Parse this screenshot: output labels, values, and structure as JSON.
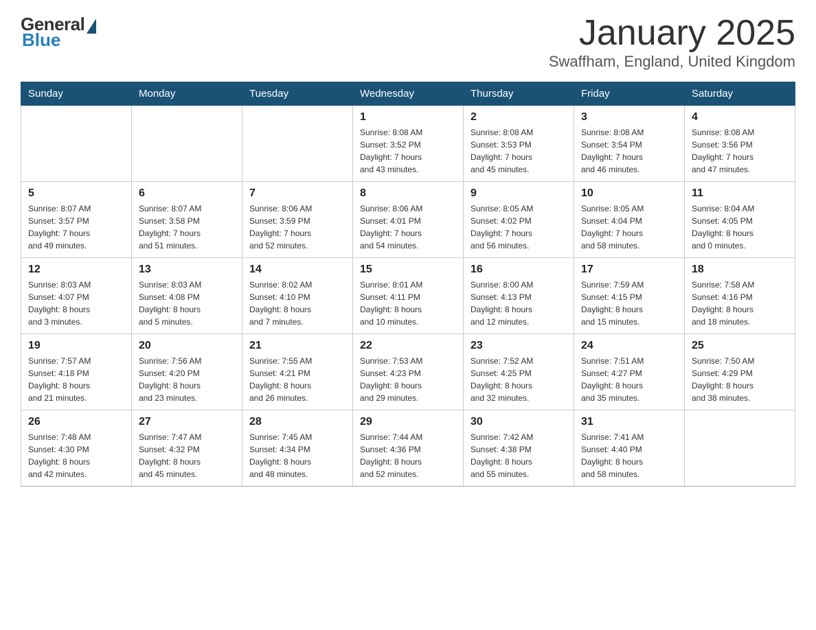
{
  "header": {
    "logo": {
      "general": "General",
      "blue": "Blue"
    },
    "title": "January 2025",
    "location": "Swaffham, England, United Kingdom"
  },
  "calendar": {
    "weekdays": [
      "Sunday",
      "Monday",
      "Tuesday",
      "Wednesday",
      "Thursday",
      "Friday",
      "Saturday"
    ],
    "weeks": [
      [
        {
          "day": "",
          "info": ""
        },
        {
          "day": "",
          "info": ""
        },
        {
          "day": "",
          "info": ""
        },
        {
          "day": "1",
          "info": "Sunrise: 8:08 AM\nSunset: 3:52 PM\nDaylight: 7 hours\nand 43 minutes."
        },
        {
          "day": "2",
          "info": "Sunrise: 8:08 AM\nSunset: 3:53 PM\nDaylight: 7 hours\nand 45 minutes."
        },
        {
          "day": "3",
          "info": "Sunrise: 8:08 AM\nSunset: 3:54 PM\nDaylight: 7 hours\nand 46 minutes."
        },
        {
          "day": "4",
          "info": "Sunrise: 8:08 AM\nSunset: 3:56 PM\nDaylight: 7 hours\nand 47 minutes."
        }
      ],
      [
        {
          "day": "5",
          "info": "Sunrise: 8:07 AM\nSunset: 3:57 PM\nDaylight: 7 hours\nand 49 minutes."
        },
        {
          "day": "6",
          "info": "Sunrise: 8:07 AM\nSunset: 3:58 PM\nDaylight: 7 hours\nand 51 minutes."
        },
        {
          "day": "7",
          "info": "Sunrise: 8:06 AM\nSunset: 3:59 PM\nDaylight: 7 hours\nand 52 minutes."
        },
        {
          "day": "8",
          "info": "Sunrise: 8:06 AM\nSunset: 4:01 PM\nDaylight: 7 hours\nand 54 minutes."
        },
        {
          "day": "9",
          "info": "Sunrise: 8:05 AM\nSunset: 4:02 PM\nDaylight: 7 hours\nand 56 minutes."
        },
        {
          "day": "10",
          "info": "Sunrise: 8:05 AM\nSunset: 4:04 PM\nDaylight: 7 hours\nand 58 minutes."
        },
        {
          "day": "11",
          "info": "Sunrise: 8:04 AM\nSunset: 4:05 PM\nDaylight: 8 hours\nand 0 minutes."
        }
      ],
      [
        {
          "day": "12",
          "info": "Sunrise: 8:03 AM\nSunset: 4:07 PM\nDaylight: 8 hours\nand 3 minutes."
        },
        {
          "day": "13",
          "info": "Sunrise: 8:03 AM\nSunset: 4:08 PM\nDaylight: 8 hours\nand 5 minutes."
        },
        {
          "day": "14",
          "info": "Sunrise: 8:02 AM\nSunset: 4:10 PM\nDaylight: 8 hours\nand 7 minutes."
        },
        {
          "day": "15",
          "info": "Sunrise: 8:01 AM\nSunset: 4:11 PM\nDaylight: 8 hours\nand 10 minutes."
        },
        {
          "day": "16",
          "info": "Sunrise: 8:00 AM\nSunset: 4:13 PM\nDaylight: 8 hours\nand 12 minutes."
        },
        {
          "day": "17",
          "info": "Sunrise: 7:59 AM\nSunset: 4:15 PM\nDaylight: 8 hours\nand 15 minutes."
        },
        {
          "day": "18",
          "info": "Sunrise: 7:58 AM\nSunset: 4:16 PM\nDaylight: 8 hours\nand 18 minutes."
        }
      ],
      [
        {
          "day": "19",
          "info": "Sunrise: 7:57 AM\nSunset: 4:18 PM\nDaylight: 8 hours\nand 21 minutes."
        },
        {
          "day": "20",
          "info": "Sunrise: 7:56 AM\nSunset: 4:20 PM\nDaylight: 8 hours\nand 23 minutes."
        },
        {
          "day": "21",
          "info": "Sunrise: 7:55 AM\nSunset: 4:21 PM\nDaylight: 8 hours\nand 26 minutes."
        },
        {
          "day": "22",
          "info": "Sunrise: 7:53 AM\nSunset: 4:23 PM\nDaylight: 8 hours\nand 29 minutes."
        },
        {
          "day": "23",
          "info": "Sunrise: 7:52 AM\nSunset: 4:25 PM\nDaylight: 8 hours\nand 32 minutes."
        },
        {
          "day": "24",
          "info": "Sunrise: 7:51 AM\nSunset: 4:27 PM\nDaylight: 8 hours\nand 35 minutes."
        },
        {
          "day": "25",
          "info": "Sunrise: 7:50 AM\nSunset: 4:29 PM\nDaylight: 8 hours\nand 38 minutes."
        }
      ],
      [
        {
          "day": "26",
          "info": "Sunrise: 7:48 AM\nSunset: 4:30 PM\nDaylight: 8 hours\nand 42 minutes."
        },
        {
          "day": "27",
          "info": "Sunrise: 7:47 AM\nSunset: 4:32 PM\nDaylight: 8 hours\nand 45 minutes."
        },
        {
          "day": "28",
          "info": "Sunrise: 7:45 AM\nSunset: 4:34 PM\nDaylight: 8 hours\nand 48 minutes."
        },
        {
          "day": "29",
          "info": "Sunrise: 7:44 AM\nSunset: 4:36 PM\nDaylight: 8 hours\nand 52 minutes."
        },
        {
          "day": "30",
          "info": "Sunrise: 7:42 AM\nSunset: 4:38 PM\nDaylight: 8 hours\nand 55 minutes."
        },
        {
          "day": "31",
          "info": "Sunrise: 7:41 AM\nSunset: 4:40 PM\nDaylight: 8 hours\nand 58 minutes."
        },
        {
          "day": "",
          "info": ""
        }
      ]
    ]
  }
}
